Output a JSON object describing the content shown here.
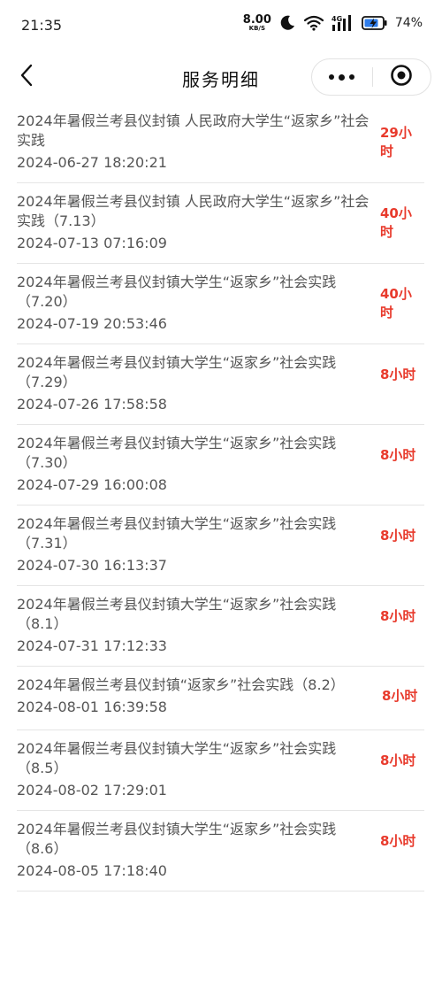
{
  "status_bar": {
    "time": "21:35",
    "net_speed_value": "8.00",
    "net_speed_unit": "KB/S",
    "network_label": "4G",
    "battery_percent": "74%",
    "icons": [
      "moon-icon",
      "wifi-icon",
      "signal-4g-icon",
      "battery-charging-icon"
    ]
  },
  "nav": {
    "title": "服务明细",
    "back_icon": "chevron-left-icon",
    "more_icon": "more-dots-icon",
    "close_icon": "target-circle-icon"
  },
  "accent_color": "#e83a2c",
  "records": [
    {
      "title": "2024年暑假兰考县仪封镇 人民政府大学生“返家乡”社会实践",
      "time": "2024-06-27 18:20:21",
      "hours": "29小时"
    },
    {
      "title": "2024年暑假兰考县仪封镇 人民政府大学生“返家乡”社会实践（7.13）",
      "time": "2024-07-13 07:16:09",
      "hours": "40小时"
    },
    {
      "title": "2024年暑假兰考县仪封镇大学生“返家乡”社会实践（7.20）",
      "time": "2024-07-19 20:53:46",
      "hours": "40小时"
    },
    {
      "title": "2024年暑假兰考县仪封镇大学生“返家乡”社会实践（7.29）",
      "time": "2024-07-26 17:58:58",
      "hours": "8小时"
    },
    {
      "title": "2024年暑假兰考县仪封镇大学生“返家乡”社会实践（7.30）",
      "time": "2024-07-29 16:00:08",
      "hours": "8小时"
    },
    {
      "title": "2024年暑假兰考县仪封镇大学生“返家乡”社会实践（7.31）",
      "time": "2024-07-30 16:13:37",
      "hours": "8小时"
    },
    {
      "title": "2024年暑假兰考县仪封镇大学生“返家乡”社会实践（8.1）",
      "time": "2024-07-31 17:12:33",
      "hours": "8小时"
    },
    {
      "title": "2024年暑假兰考县仪封镇“返家乡”社会实践（8.2）",
      "time": "2024-08-01 16:39:58",
      "hours": "8小时"
    },
    {
      "title": "2024年暑假兰考县仪封镇大学生“返家乡”社会实践（8.5）",
      "time": "2024-08-02 17:29:01",
      "hours": "8小时"
    },
    {
      "title": "2024年暑假兰考县仪封镇大学生“返家乡”社会实践（8.6）",
      "time": "2024-08-05 17:18:40",
      "hours": "8小时"
    }
  ]
}
